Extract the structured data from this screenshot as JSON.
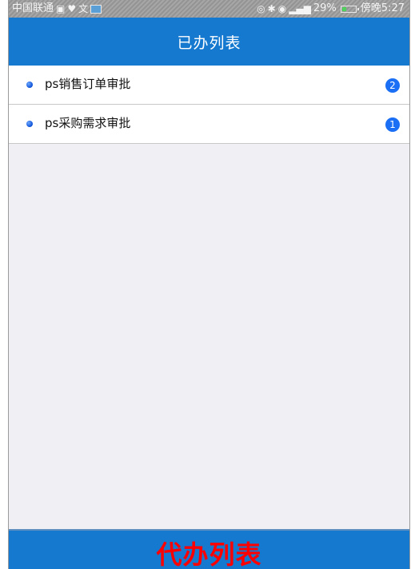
{
  "status_bar": {
    "carrier": "中国联通",
    "left_icons": [
      "briefcase-icon",
      "heart-icon",
      "app-icon",
      "image-icon"
    ],
    "right_icons": [
      "nfc-icon",
      "bluetooth-icon",
      "eye-icon",
      "signal-icon"
    ],
    "battery": "29%",
    "battery_level": 0.29,
    "time": "傍晚5:27"
  },
  "header": {
    "title": "已办列表"
  },
  "list": {
    "items": [
      {
        "label": "ps销售订单审批",
        "count": "2"
      },
      {
        "label": "ps采购需求审批",
        "count": "1"
      }
    ]
  },
  "footer": {
    "label": "代办列表",
    "label_color": "#ff0000"
  },
  "colors": {
    "accent": "#1579d0",
    "badge": "#1b6ff5",
    "background": "#efeff4"
  }
}
